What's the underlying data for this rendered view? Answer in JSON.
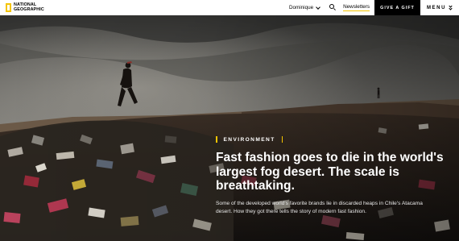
{
  "header": {
    "logo_line1": "NATIONAL",
    "logo_line2": "GEOGRAPHIC",
    "user_name": "Dominique",
    "newsletters_label": "Newsletters",
    "gift_label": "GIVE A GIFT",
    "menu_label": "MENU"
  },
  "article": {
    "category": "ENVIRONMENT",
    "headline": "Fast fashion goes to die in the world's largest fog desert. The scale is breathtaking.",
    "dek": "Some of the developed world's favorite brands lie in discarded heaps in Chile's Atacama desert. How they got there tells the story of modern fast fashion."
  },
  "colors": {
    "brand_yellow": "#f4c400",
    "header_bg": "#ffffff",
    "gift_bg": "#000000"
  },
  "icons": [
    "chevron-down-icon",
    "search-icon",
    "double-chevron-icon"
  ]
}
